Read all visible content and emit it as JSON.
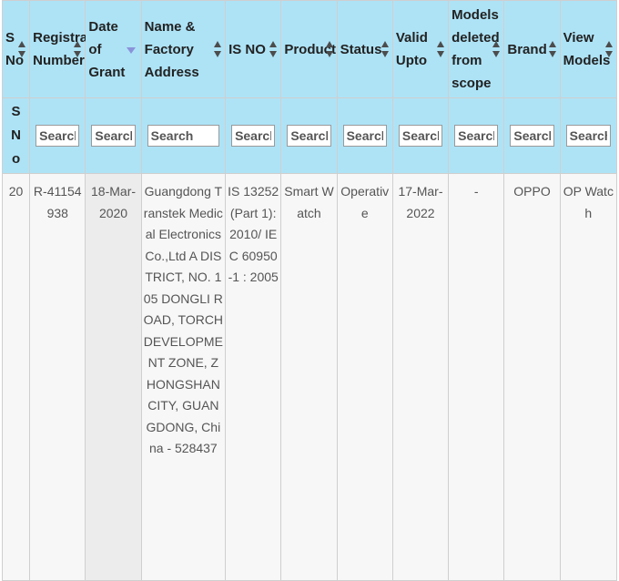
{
  "columns": [
    {
      "key": "sno",
      "label": "S No",
      "sort": "both"
    },
    {
      "key": "reg",
      "label": "Registration Number",
      "sort": "both"
    },
    {
      "key": "date",
      "label": "Date of Grant",
      "sort": "desc"
    },
    {
      "key": "name",
      "label": "Name & Factory Address",
      "sort": "both"
    },
    {
      "key": "isno",
      "label": "IS NO",
      "sort": "both"
    },
    {
      "key": "product",
      "label": "Product",
      "sort": "both"
    },
    {
      "key": "status",
      "label": "Status",
      "sort": "both"
    },
    {
      "key": "valid",
      "label": "Valid Upto",
      "sort": "both"
    },
    {
      "key": "deleted",
      "label": "Models deleted from scope",
      "sort": "both"
    },
    {
      "key": "brand",
      "label": "Brand",
      "sort": "both"
    },
    {
      "key": "view",
      "label": "View Models",
      "sort": "both"
    }
  ],
  "search_row": {
    "first_cell_label": "S N o",
    "placeholder": "Search"
  },
  "rows": [
    {
      "sno": "20",
      "reg": "R-41154938",
      "date": "18-Mar-2020",
      "name": "Guangdong Transtek Medical Electronics Co.,Ltd A DISTRICT, NO. 105 DONGLI ROAD, TORCH DEVELOPMENT ZONE, ZHONGSHAN CITY, GUANGDONG, China - 528437",
      "isno": "IS 13252(Part 1):2010/ IEC 60950-1 : 2005",
      "product": "Smart Watch",
      "status": "Operative",
      "valid": "17-Mar-2022",
      "deleted": "-",
      "brand": "OPPO",
      "view": "OP Watch"
    }
  ]
}
